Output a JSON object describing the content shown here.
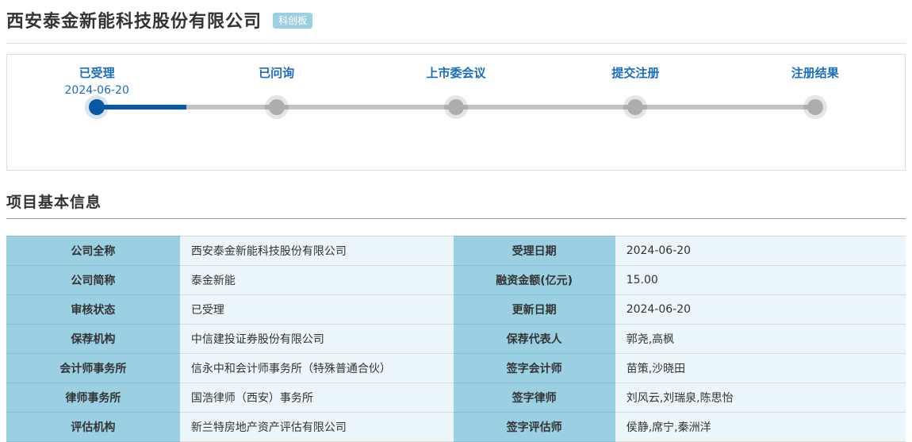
{
  "page": {
    "title": "西安泰金新能科技股份有限公司",
    "board_badge": "科创板"
  },
  "timeline": {
    "stages": [
      {
        "label": "已受理",
        "date": "2024-06-20",
        "state": "active"
      },
      {
        "label": "已问询",
        "date": "",
        "state": "pending"
      },
      {
        "label": "上市委会议",
        "date": "",
        "state": "pending"
      },
      {
        "label": "提交注册",
        "date": "",
        "state": "pending"
      },
      {
        "label": "注册结果",
        "date": "",
        "state": "pending"
      }
    ],
    "colors": {
      "active": "#0a57a4",
      "inactive": "#adadad",
      "label": "#1a6cbd"
    }
  },
  "section": {
    "title": "项目基本信息"
  },
  "info_table": {
    "rows": [
      {
        "label_left": "公司全称",
        "value_left": "西安泰金新能科技股份有限公司",
        "label_right": "受理日期",
        "value_right": "2024-06-20"
      },
      {
        "label_left": "公司简称",
        "value_left": "泰金新能",
        "label_right": "融资金额(亿元)",
        "value_right": "15.00"
      },
      {
        "label_left": "审核状态",
        "value_left": "已受理",
        "label_right": "更新日期",
        "value_right": "2024-06-20"
      },
      {
        "label_left": "保荐机构",
        "value_left": "中信建投证券股份有限公司",
        "label_right": "保荐代表人",
        "value_right": "郭尧,高枫"
      },
      {
        "label_left": "会计师事务所",
        "value_left": "信永中和会计师事务所（特殊普通合伙）",
        "label_right": "签字会计师",
        "value_right": "苗策,沙晓田"
      },
      {
        "label_left": "律师事务所",
        "value_left": "国浩律师（西安）事务所",
        "label_right": "签字律师",
        "value_right": "刘风云,刘瑞泉,陈思怡"
      },
      {
        "label_left": "评估机构",
        "value_left": "新兰特房地产资产评估有限公司",
        "label_right": "签字评估师",
        "value_right": "侯静,席宁,秦洲洋"
      }
    ]
  }
}
